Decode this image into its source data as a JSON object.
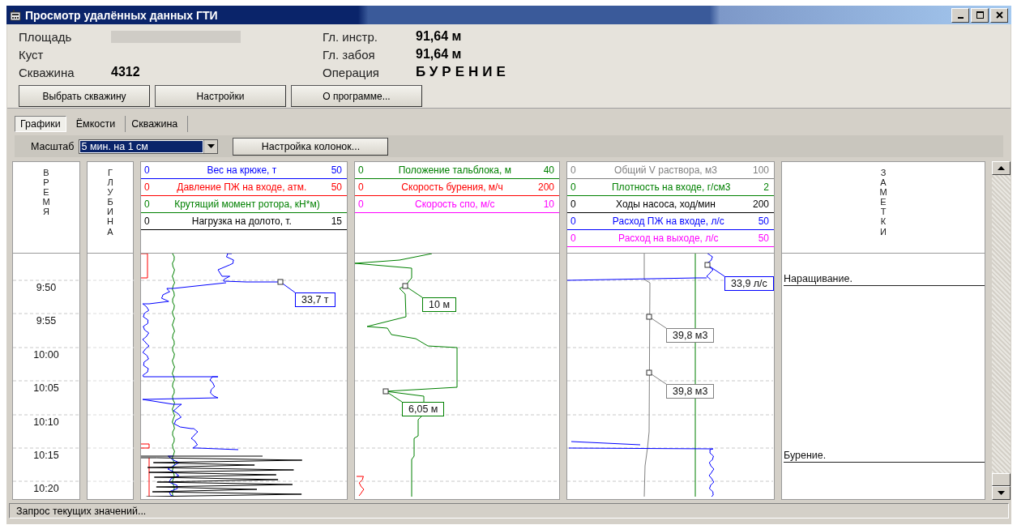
{
  "window": {
    "title": "Просмотр удалённых данных ГТИ"
  },
  "header": {
    "left_fields": [
      {
        "label": "Площадь",
        "redacted": true
      },
      {
        "label": "Куст"
      },
      {
        "label": "Скважина",
        "value": "4312"
      }
    ],
    "right_fields": [
      {
        "label": "Гл. инстр.",
        "value": "91,64 м",
        "kind": "value"
      },
      {
        "label": "Гл. забоя",
        "value": "91,64 м",
        "kind": "value"
      },
      {
        "label": "Операция",
        "value": "БУРЕНИЕ",
        "kind": "operation"
      }
    ],
    "buttons": [
      "Выбрать скважину",
      "Настройки",
      "О программе..."
    ]
  },
  "tabs": [
    {
      "label": "Графики",
      "selected": true
    },
    {
      "label": "Ёмкости",
      "selected": false
    },
    {
      "label": "Скважина",
      "selected": false
    }
  ],
  "toolbar": {
    "scale_label": "Масштаб",
    "scale_value": "5 мин. на 1 см",
    "columns_button": "Настройка колонок..."
  },
  "time_column": {
    "title": "ВРЕМЯ",
    "ticks": [
      "9:50",
      "9:55",
      "10:00",
      "10:05",
      "10:10",
      "10:15",
      "10:20"
    ]
  },
  "depth_column": {
    "title": "ГЛУБИНА"
  },
  "tracks": [
    {
      "legend": [
        {
          "min": "0",
          "name": "Вес на крюке, т",
          "max": "50",
          "color": "#0000ff"
        },
        {
          "min": "0",
          "name": "Давление ПЖ на входе, атм.",
          "max": "50",
          "color": "#ff0000"
        },
        {
          "min": "0",
          "name": "Крутящий момент ротора, кН*м)",
          "color": "#008000"
        },
        {
          "min": "0",
          "name": "Нагрузка на долото, т.",
          "max": "15",
          "color": "#000000"
        }
      ],
      "callouts": [
        {
          "text": "33,7 т",
          "color": "#0000ff"
        }
      ]
    },
    {
      "legend": [
        {
          "min": "0",
          "name": "Положение тальблока, м",
          "max": "40",
          "color": "#008000"
        },
        {
          "min": "0",
          "name": "Скорость бурения, м/ч",
          "max": "200",
          "color": "#ff0000"
        },
        {
          "min": "0",
          "name": "Скорость спо, м/с",
          "max": "10",
          "color": "#ff00ff"
        }
      ],
      "callouts": [
        {
          "text": "10 м",
          "color": "#008000"
        },
        {
          "text": "6,05 м",
          "color": "#008000"
        }
      ]
    },
    {
      "legend": [
        {
          "min": "0",
          "name": "Общий V раствора, м3",
          "max": "100",
          "color": "#808080"
        },
        {
          "min": "0",
          "name": "Плотность на входе, г/см3",
          "max": "2",
          "color": "#008000"
        },
        {
          "min": "0",
          "name": "Ходы насоса, ход/мин",
          "max": "200",
          "color": "#000000"
        },
        {
          "min": "0",
          "name": "Расход ПЖ на входе, л/с",
          "max": "50",
          "color": "#0000ff"
        },
        {
          "min": "0",
          "name": "Расход на выходе, л/с",
          "max": "50",
          "color": "#ff00ff"
        }
      ],
      "callouts": [
        {
          "text": "33,9 л/с",
          "color": "#0000ff"
        },
        {
          "text": "39,8 м3",
          "color": "#808080"
        },
        {
          "text": "39,8 м3",
          "color": "#808080"
        }
      ]
    }
  ],
  "notes_column": {
    "title": "ЗАМЕТКИ",
    "entries": [
      {
        "text": "Наращивание."
      },
      {
        "text": "Бурение."
      }
    ]
  },
  "status_bar": "Запрос текущих значений..."
}
